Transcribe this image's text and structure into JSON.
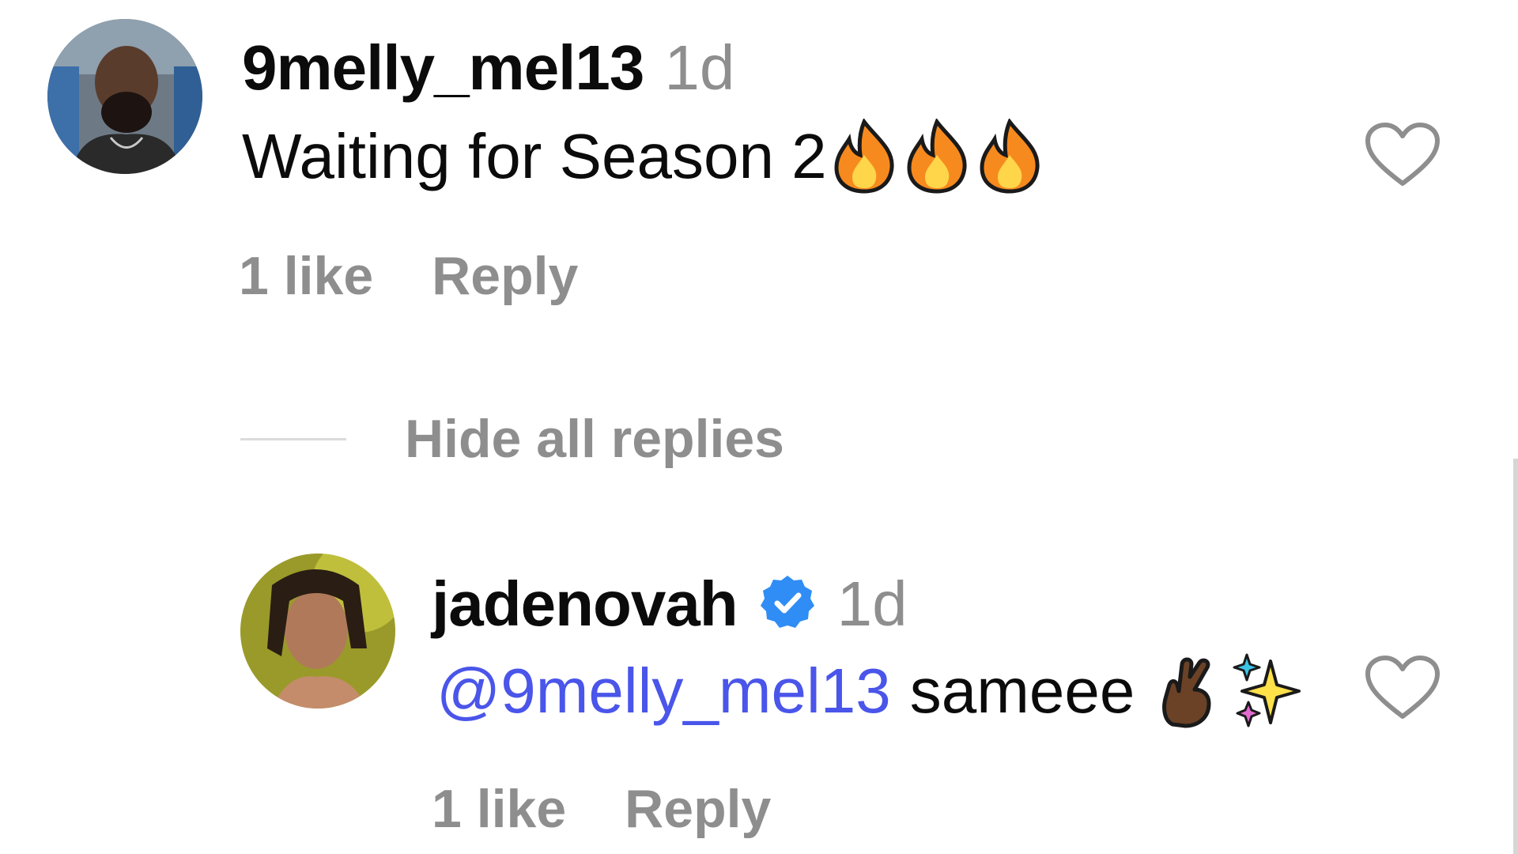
{
  "comment": {
    "username": "9melly_mel13",
    "time": "1d",
    "text": "Waiting for Season 2",
    "emojis": [
      "fire-emoji",
      "fire-emoji",
      "fire-emoji"
    ],
    "likes": "1 like",
    "reply_label": "Reply",
    "liked": false
  },
  "replies_toggle": {
    "label": "Hide all replies"
  },
  "reply": {
    "username": "jadenovah",
    "verified": true,
    "time": "1d",
    "mention": "@9melly_mel13",
    "text": "sameee",
    "emojis": [
      "crossed-fingers-emoji",
      "sparkles-emoji"
    ],
    "likes": "1 like",
    "reply_label": "Reply",
    "liked": false
  },
  "colors": {
    "username": "#0b0b0b",
    "secondary_text": "#8e8e8e",
    "mention": "#4a55ea",
    "verified_badge": "#2f8df5",
    "divider": "#dbdbdb"
  }
}
